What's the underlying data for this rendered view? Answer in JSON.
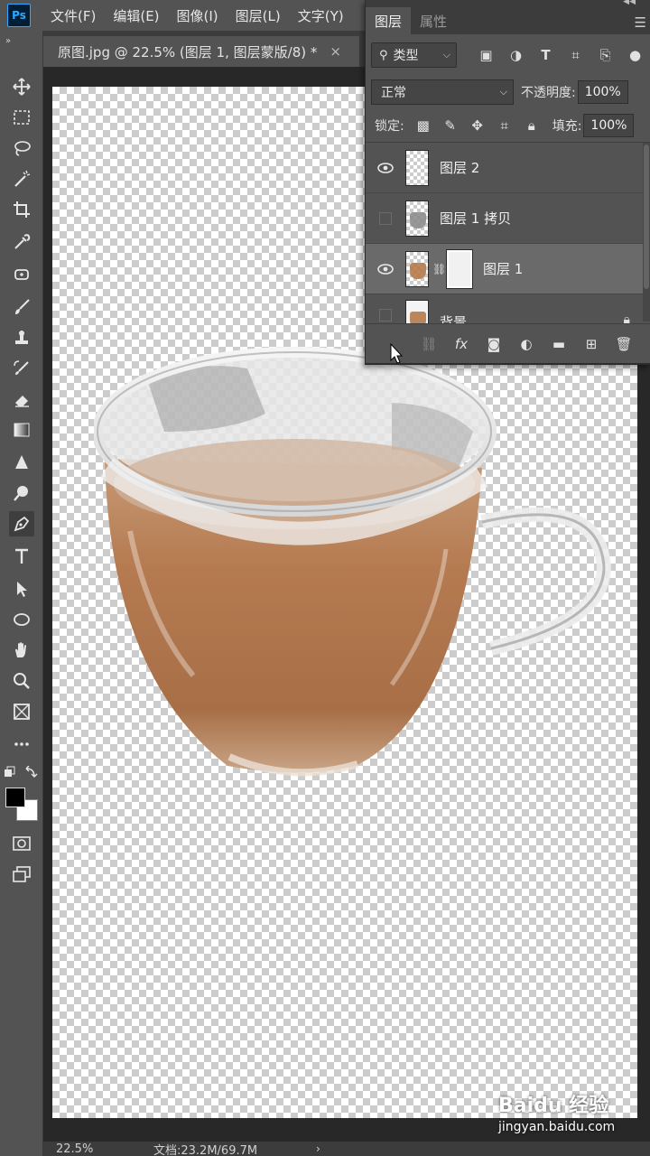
{
  "app": {
    "logo": "Ps"
  },
  "menu": [
    "文件(F)",
    "编辑(E)",
    "图像(I)",
    "图层(L)",
    "文字(Y)"
  ],
  "document": {
    "tab_title": "原图.jpg @ 22.5% (图层 1, 图层蒙版/8) *",
    "close": "×"
  },
  "toolbar": {
    "collapse": "»",
    "tools": [
      "move-icon",
      "marquee-icon",
      "lasso-icon",
      "magic-wand-icon",
      "crop-icon",
      "eyedropper-icon",
      "healing-brush-icon",
      "brush-icon",
      "clone-stamp-icon",
      "history-brush-icon",
      "eraser-icon",
      "gradient-icon",
      "blur-icon",
      "dodge-icon",
      "pen-icon",
      "type-icon",
      "path-selection-icon",
      "ellipse-icon",
      "hand-icon",
      "zoom-icon",
      "frame-icon",
      "more-tools-icon"
    ],
    "active_tool": "pen-icon",
    "foreground_color": "#000000",
    "background_color": "#ffffff"
  },
  "layers_panel": {
    "tabs": [
      "图层",
      "属性"
    ],
    "active_tab": "图层",
    "filter_kind": "类型",
    "blend_mode": "正常",
    "opacity_label": "不透明度:",
    "opacity_value": "100%",
    "lock_label": "锁定:",
    "fill_label": "填充:",
    "fill_value": "100%",
    "layers": [
      {
        "name": "图层 2",
        "visible": true,
        "selected": false
      },
      {
        "name": "图层 1 拷贝",
        "visible": false,
        "selected": false
      },
      {
        "name": "图层 1",
        "visible": true,
        "selected": true,
        "has_mask": true
      },
      {
        "name": "背景",
        "visible": false,
        "selected": false,
        "locked": true
      }
    ]
  },
  "status": {
    "zoom": "22.5%",
    "doc_info": "文档:23.2M/69.7M",
    "arrow": "›"
  },
  "watermark": {
    "brand": "Baidu 经验",
    "url": "jingyan.baidu.com"
  }
}
